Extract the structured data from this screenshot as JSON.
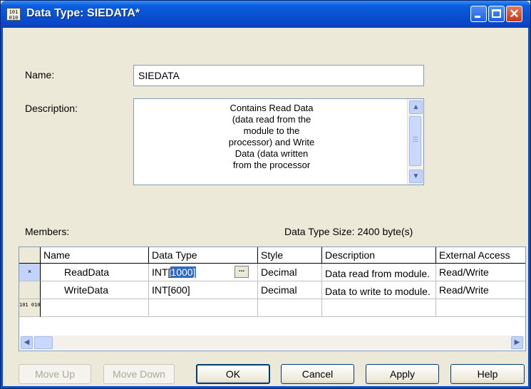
{
  "window": {
    "title": "Data Type:  SIEDATA*",
    "app_icon_text": "101 010"
  },
  "form": {
    "name_label": "Name:",
    "name_value": "SIEDATA",
    "description_label": "Description:",
    "description_lines": [
      "Contains Read Data",
      "(data read from the",
      "module to the",
      "processor) and Write",
      "Data (data written",
      "from the processor"
    ],
    "members_label": "Members:",
    "size_label": "Data Type Size: 2400 byte(s)"
  },
  "grid": {
    "columns": [
      "Name",
      "Data Type",
      "Style",
      "Description",
      "External Access"
    ],
    "rows": [
      {
        "marker": "×",
        "name": "ReadData",
        "data_type_prefix": "INT[",
        "data_type_selected": "1000]",
        "style": "Decimal",
        "description": "Data read from module.",
        "access": "Read/Write"
      },
      {
        "marker": "",
        "name": "WriteData",
        "data_type": "INT[600]",
        "style": "Decimal",
        "description": "Data to write to module.",
        "access": "Read/Write"
      }
    ],
    "new_row_marker": "101 010"
  },
  "buttons": {
    "move_up": "Move Up",
    "move_down": "Move Down",
    "ok": "OK",
    "cancel": "Cancel",
    "apply": "Apply",
    "help": "Help"
  }
}
